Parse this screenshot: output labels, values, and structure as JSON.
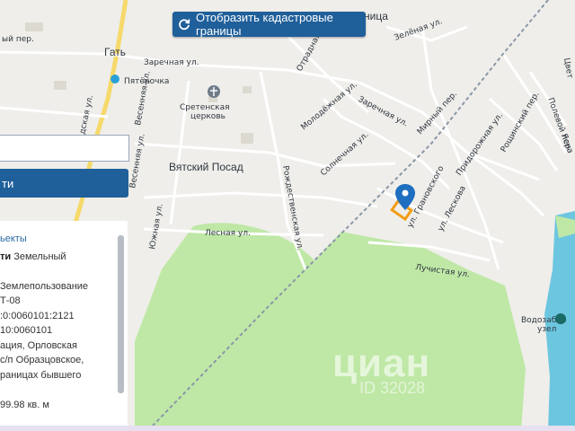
{
  "map": {
    "places": {
      "gat": "Гать",
      "vyatsky": "Вятский Посад",
      "izza": "ница",
      "pyaterochka": "Пятёрочка",
      "church": "Сретенская\nцерковь",
      "vodozabor": "Водозабор\nузел"
    },
    "streets": [
      "Заречная ул.",
      "Заречная ул.",
      "Зелёная ул.",
      "Отрадная ул.",
      "Молодёжная ул.",
      "Мирный пер.",
      "Весенняя ул.",
      "Весенняя ул.",
      "Рождественская ул.",
      "Солнечная ул.",
      "Лесная ул.",
      "Южная ул.",
      "ул. Грановского",
      "ул. Лескова",
      "Лучистая ул.",
      "Придорожная ул.",
      "Рощинский пер.",
      "Полевой пер.",
      "Ясна",
      "Цвет",
      "ый пер.",
      "дская ул."
    ]
  },
  "cadastral_button": {
    "label": "Отобразить кадастровые границы",
    "icon": "refresh-icon"
  },
  "search": {
    "value": ""
  },
  "side_button": {
    "label": "ти"
  },
  "info_panel": {
    "header": "ьекты",
    "lines": [
      {
        "bold": "ти",
        "text": " Земельный"
      },
      {
        "text": ""
      },
      {
        "text": "Землепользование"
      },
      {
        "text": "Т-08"
      },
      {
        "text": ":0:0060101:2121"
      },
      {
        "text": "10:0060101"
      },
      {
        "text": "ация, Орловская"
      },
      {
        "text": "с/п Образцовское,"
      },
      {
        "text": "раницах бывшего"
      },
      {
        "text": ""
      },
      {
        "text": "99.98 кв. м"
      }
    ]
  },
  "watermark": {
    "brand": "циан",
    "id": "ID 32028"
  },
  "colors": {
    "accent": "#1f5f9a",
    "forest": "#bfe8a6",
    "water": "#6dc6e0",
    "parcel": "#f39c12"
  }
}
